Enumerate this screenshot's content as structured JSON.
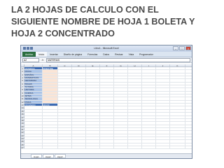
{
  "slide": {
    "title_lines": [
      "LA 2 HOJAS DE CALCULO CON EL",
      "SIGUIENTE NOMBRE DE HOJA 1 BOLETA Y",
      "HOJA 2  CONCENTRADO"
    ]
  },
  "excel": {
    "window_title": "Libro1 - Microsoft Excel",
    "ribbon_tabs": [
      "Archivo",
      "Inicio",
      "Insertar",
      "Diseño de página",
      "Fórmulas",
      "Datos",
      "Revisar",
      "Vista",
      "Programador"
    ],
    "active_tab_index": 1,
    "name_box": "A2",
    "formula_value": "MATERIAS",
    "columns": [
      "A",
      "B",
      "C",
      "D",
      "E",
      "F",
      "G",
      "H",
      "I",
      "J",
      "K"
    ],
    "rows": [
      {
        "n": "1",
        "a": "MATERIAS",
        "b": "BIMESTRE",
        "style": "header"
      },
      {
        "n": "2",
        "a": "CIVICA",
        "b": "",
        "style": "body"
      },
      {
        "n": "3",
        "a": "ESPAÑOL",
        "b": "",
        "style": "body"
      },
      {
        "n": "4",
        "a": "MATEMATICAS",
        "b": "",
        "style": "body"
      },
      {
        "n": "5",
        "a": "GEOGRAFIA",
        "b": "",
        "style": "body"
      },
      {
        "n": "6",
        "a": "INGLES",
        "b": "",
        "style": "body"
      },
      {
        "n": "7",
        "a": "TUTORIA",
        "b": "",
        "style": "body"
      },
      {
        "n": "8",
        "a": "HISTORIA",
        "b": "",
        "style": "body"
      },
      {
        "n": "9",
        "a": "QUIMICA",
        "b": "",
        "style": "body"
      },
      {
        "n": "10",
        "a": "ARTES",
        "b": "",
        "style": "body"
      },
      {
        "n": "11",
        "a": "TECNOLOGIA",
        "b": "",
        "style": "body"
      },
      {
        "n": "12",
        "a": "FISICA",
        "b": "",
        "style": "body"
      },
      {
        "n": "13",
        "a": "PROMEDIO",
        "b": "#DIV/0!",
        "style": "total"
      },
      {
        "n": "14",
        "a": "",
        "b": "",
        "style": "empty"
      },
      {
        "n": "15",
        "a": "",
        "b": "",
        "style": "empty"
      },
      {
        "n": "16",
        "a": "",
        "b": "",
        "style": "empty"
      },
      {
        "n": "17",
        "a": "",
        "b": "",
        "style": "empty"
      },
      {
        "n": "18",
        "a": "",
        "b": "",
        "style": "empty"
      },
      {
        "n": "19",
        "a": "",
        "b": "",
        "style": "empty"
      },
      {
        "n": "20",
        "a": "",
        "b": "",
        "style": "empty"
      },
      {
        "n": "21",
        "a": "",
        "b": "",
        "style": "empty"
      },
      {
        "n": "22",
        "a": "",
        "b": "",
        "style": "empty"
      },
      {
        "n": "23",
        "a": "",
        "b": "",
        "style": "empty"
      },
      {
        "n": "24",
        "a": "",
        "b": "",
        "style": "empty"
      },
      {
        "n": "25",
        "a": "",
        "b": "",
        "style": "empty"
      },
      {
        "n": "26",
        "a": "",
        "b": "",
        "style": "empty"
      },
      {
        "n": "27",
        "a": "",
        "b": "",
        "style": "empty"
      }
    ],
    "sheet_tabs": [
      "Hoja1",
      "Hoja2",
      "Hoja3"
    ],
    "colors": {
      "title_text": "#4a4a4a",
      "subject_fill": "#a9c3e8",
      "grade_fill": "#fbe5d6",
      "header_fill": "#3b6ab3",
      "file_tab": "#2b6e3f"
    }
  }
}
